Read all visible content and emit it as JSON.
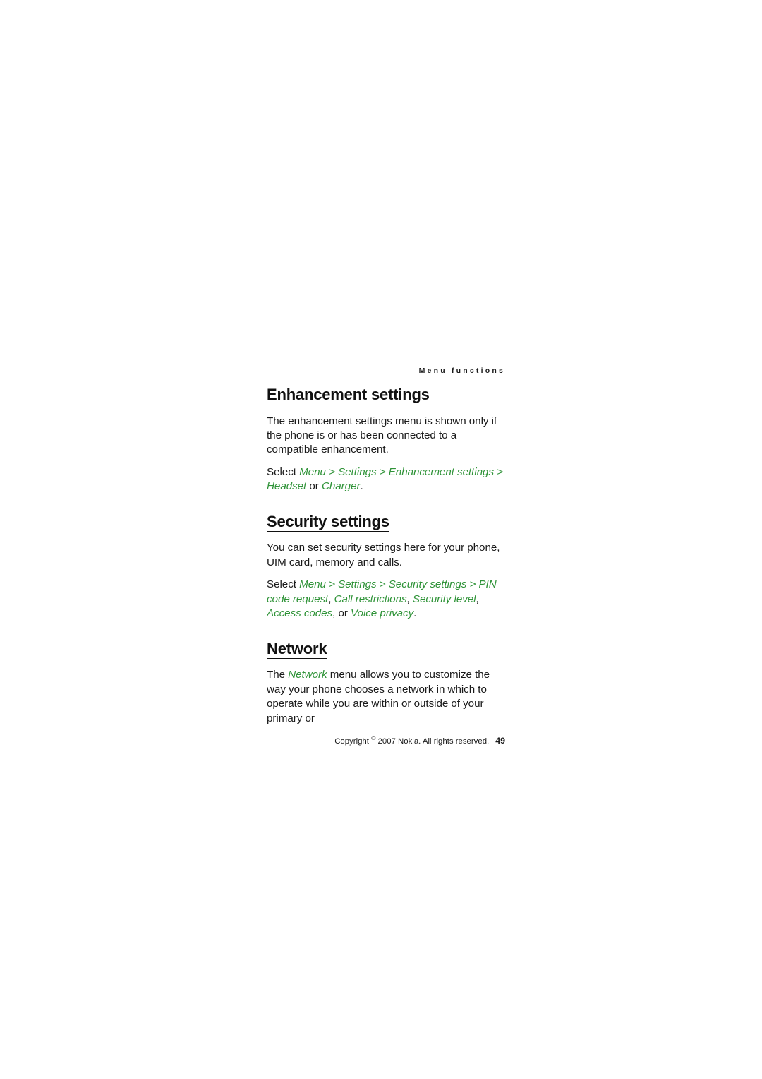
{
  "page": {
    "running_head": "Menu functions",
    "footer": {
      "copyright": "Copyright © 2007 Nokia. All rights reserved.",
      "copyright_prefix": "Copyright",
      "copyright_symbol": "©",
      "copyright_rest": "2007 Nokia. All rights reserved.",
      "page_number": "49"
    },
    "accent_green": "#2f9338",
    "text_color": "#1a1a1a"
  },
  "sections": [
    {
      "heading": "Enhancement settings",
      "paragraph": "The enhancement settings menu is shown only if the phone is or has been connected to a compatible enhancement.",
      "select_line": {
        "lead": "Select",
        "path_1": "Menu",
        "sep_1": ">",
        "path_2": "Settings",
        "sep_2": ">",
        "path_3": "Enhancement settings",
        "sep_3": ">",
        "path_4": "Headset",
        "conjunction": "or",
        "path_5": "Charger",
        "period": "."
      }
    },
    {
      "heading": "Security settings",
      "paragraph": "You can set security settings here for your phone, UIM card, memory and calls.",
      "select_line": {
        "lead": "Select",
        "path_1": "Menu",
        "sep_1": ">",
        "path_2": "Settings",
        "sep_2": ">",
        "path_3": "Security settings",
        "sep_3": ">",
        "path_4": "PIN code request",
        "comma_1": ",",
        "path_5": "Call restrictions",
        "comma_2": ",",
        "path_6": "Security level",
        "comma_3": ",",
        "path_7": "Access codes",
        "comma_4": ",",
        "conjunction": "or",
        "path_8": "Voice privacy",
        "period": "."
      }
    },
    {
      "heading": "Network",
      "paragraph_lead": "The",
      "paragraph_term": "Network",
      "paragraph_rest": "menu allows you to customize the way your phone chooses a network in which to operate while you are within or outside of your primary or"
    }
  ]
}
